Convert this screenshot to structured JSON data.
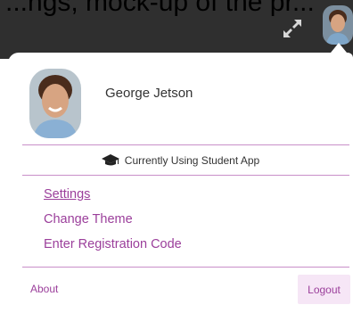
{
  "header": {
    "cutoff_text": "...ngs, mock-up of the pr...",
    "expand_icon": "expand-arrows-icon",
    "avatar_icon": "user-avatar"
  },
  "profile": {
    "name": "George Jetson",
    "avatar_icon": "user-avatar"
  },
  "status": {
    "icon": "graduation-cap-icon",
    "text": "Currently Using Student App"
  },
  "menu": {
    "items": [
      {
        "label": "Settings"
      },
      {
        "label": "Change Theme"
      },
      {
        "label": "Enter Registration Code"
      }
    ]
  },
  "footer": {
    "about_label": "About",
    "logout_label": "Logout"
  },
  "colors": {
    "accent": "#9b3f9b",
    "divider": "#c98fc9",
    "header_bg": "#2f2f2f",
    "logout_bg": "#f6e6f6"
  }
}
